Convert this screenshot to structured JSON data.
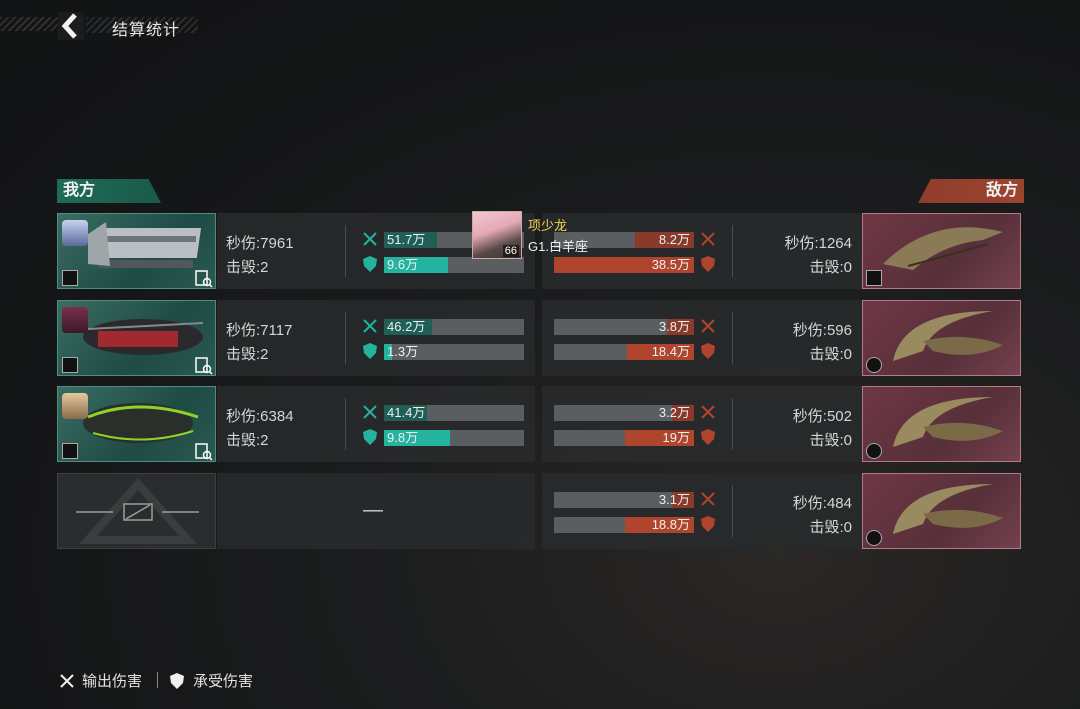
{
  "header": {
    "title": "结算统计"
  },
  "sides": {
    "ours": "我方",
    "enemy": "敌方"
  },
  "stat_labels": {
    "dps": "秒伤:",
    "kills": "击毁:"
  },
  "ours": [
    {
      "dps": "7961",
      "kills": "2",
      "damage": "51.7万",
      "damage_ratio": 0.38,
      "taken": "9.6万",
      "taken_ratio": 0.46
    },
    {
      "dps": "7117",
      "kills": "2",
      "damage": "46.2万",
      "damage_ratio": 0.34,
      "taken": "1.3万",
      "taken_ratio": 0.06
    },
    {
      "dps": "6384",
      "kills": "2",
      "damage": "41.4万",
      "damage_ratio": 0.31,
      "taken": "9.8万",
      "taken_ratio": 0.47
    }
  ],
  "ours_empty": {
    "dash": "—"
  },
  "enemy": [
    {
      "dps": "1264",
      "kills": "0",
      "damage": "8.2万",
      "damage_ratio": 0.42,
      "taken": "38.5万",
      "taken_ratio": 1.0
    },
    {
      "dps": "596",
      "kills": "0",
      "damage": "3.8万",
      "damage_ratio": 0.19,
      "taken": "18.4万",
      "taken_ratio": 0.48
    },
    {
      "dps": "502",
      "kills": "0",
      "damage": "3.2万",
      "damage_ratio": 0.16,
      "taken": "19万",
      "taken_ratio": 0.49
    },
    {
      "dps": "484",
      "kills": "0",
      "damage": "3.1万",
      "damage_ratio": 0.16,
      "taken": "18.8万",
      "taken_ratio": 0.49
    }
  ],
  "tooltip": {
    "name": "项少龙",
    "subtitle": "G1.白羊座",
    "level": "66"
  },
  "legend": {
    "damage_out": "输出伤害",
    "damage_taken": "承受伤害"
  },
  "colors": {
    "ours_accent": "#23b39e",
    "enemy_accent": "#b0452e",
    "tooltip_name": "#f3d64e"
  }
}
